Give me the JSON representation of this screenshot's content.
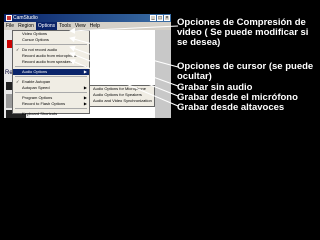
{
  "window": {
    "title": "CamStudio"
  },
  "menubar": [
    "File",
    "Region",
    "Options",
    "Tools",
    "View",
    "Help"
  ],
  "options_menu": [
    {
      "label": "Video Options",
      "check": false,
      "arrow": false
    },
    {
      "label": "Cursor Options",
      "check": false,
      "arrow": false
    },
    {
      "sep": true
    },
    {
      "label": "Do not record audio",
      "check": true,
      "arrow": false
    },
    {
      "label": "Record audio from microphone",
      "check": false,
      "arrow": false
    },
    {
      "label": "Record audio from speakers",
      "check": false,
      "arrow": false
    },
    {
      "sep": true
    },
    {
      "label": "Audio Options",
      "check": false,
      "arrow": true,
      "highlight": true
    },
    {
      "sep": true
    },
    {
      "label": "Enable Autopan",
      "check": true,
      "arrow": false
    },
    {
      "label": "Autopan Speed",
      "check": false,
      "arrow": true
    },
    {
      "sep": true
    },
    {
      "label": "Program Options",
      "check": false,
      "arrow": true
    },
    {
      "label": "Record to Flash Options",
      "check": false,
      "arrow": true
    },
    {
      "sep": true
    },
    {
      "label": "Keyboard Shortcuts",
      "check": false,
      "arrow": false
    }
  ],
  "audio_submenu": [
    "Audio Options for Microphone",
    "Audio Options for Speakers",
    "Audio and Video Synchronization"
  ],
  "toolbar_text": "Rend",
  "annotations": [
    {
      "text": "Opciones de Compresión de video ( Se puede modificar si se desea)"
    },
    {
      "text": "Opciones de cursor (se puede ocultar)"
    },
    {
      "text": "Grabar sin audio"
    },
    {
      "text": "Grabar desde el  micrófono"
    },
    {
      "text": "Grabar desde altavoces"
    }
  ],
  "colors": {
    "background": "#000000",
    "arrow": "#ffffff",
    "highlight": "#0a246a"
  }
}
